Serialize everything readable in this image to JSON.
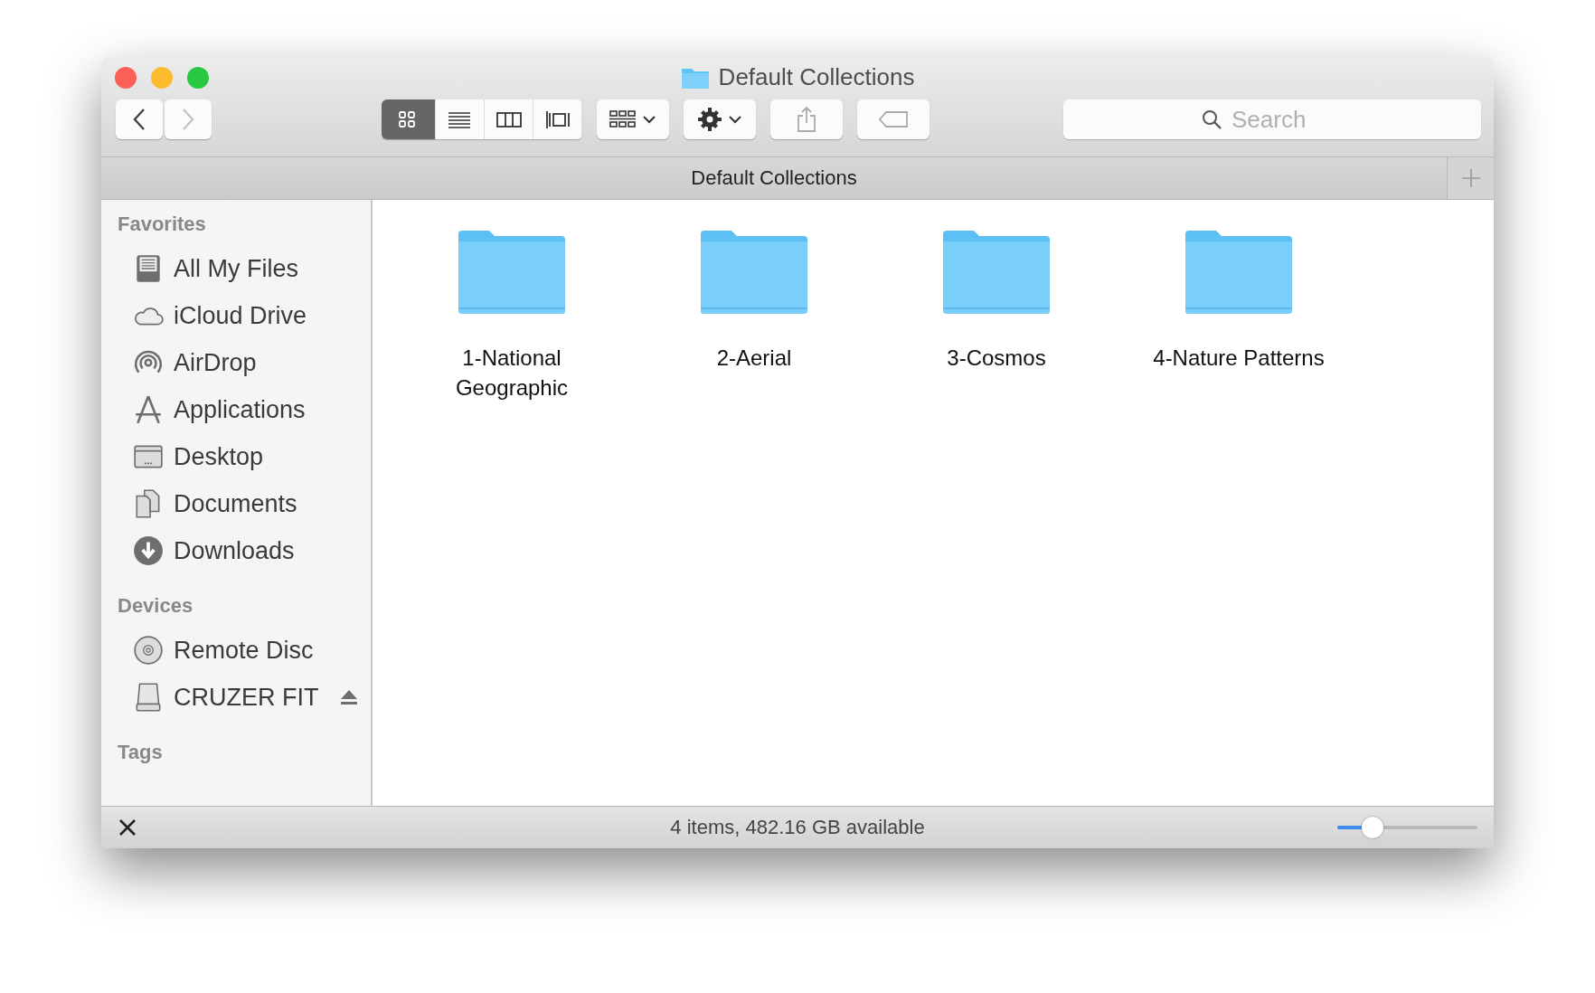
{
  "window": {
    "title": "Default Collections"
  },
  "toolbar": {
    "back": {
      "disabled": false
    },
    "forward": {
      "disabled": true
    },
    "view_modes": [
      {
        "kind": "icon",
        "selected": true
      },
      {
        "kind": "list",
        "selected": false
      },
      {
        "kind": "column",
        "selected": false
      },
      {
        "kind": "coverflow",
        "selected": false
      }
    ],
    "search": {
      "placeholder": "Search"
    }
  },
  "tab_bar": {
    "title": "Default Collections"
  },
  "sidebar": {
    "sections": [
      {
        "title": "Favorites",
        "items": [
          {
            "label": "All My Files",
            "kind": "files",
            "ejectable": false
          },
          {
            "label": "iCloud Drive",
            "kind": "cloud",
            "ejectable": false
          },
          {
            "label": "AirDrop",
            "kind": "airdrop",
            "ejectable": false
          },
          {
            "label": "Applications",
            "kind": "apps",
            "ejectable": false
          },
          {
            "label": "Desktop",
            "kind": "desktop",
            "ejectable": false
          },
          {
            "label": "Documents",
            "kind": "documents",
            "ejectable": false
          },
          {
            "label": "Downloads",
            "kind": "downloads",
            "ejectable": false
          }
        ]
      },
      {
        "title": "Devices",
        "items": [
          {
            "label": "Remote Disc",
            "kind": "disc",
            "ejectable": false
          },
          {
            "label": "CRUZER FIT",
            "kind": "drive",
            "ejectable": true
          }
        ]
      },
      {
        "title": "Tags"
      }
    ]
  },
  "folders": [
    {
      "name": "1-National Geographic"
    },
    {
      "name": "2-Aerial"
    },
    {
      "name": "3-Cosmos"
    },
    {
      "name": "4-Nature Patterns"
    }
  ],
  "status_bar": {
    "text": "4 items, 482.16 GB available",
    "zoom": {
      "level": 0.25
    }
  }
}
